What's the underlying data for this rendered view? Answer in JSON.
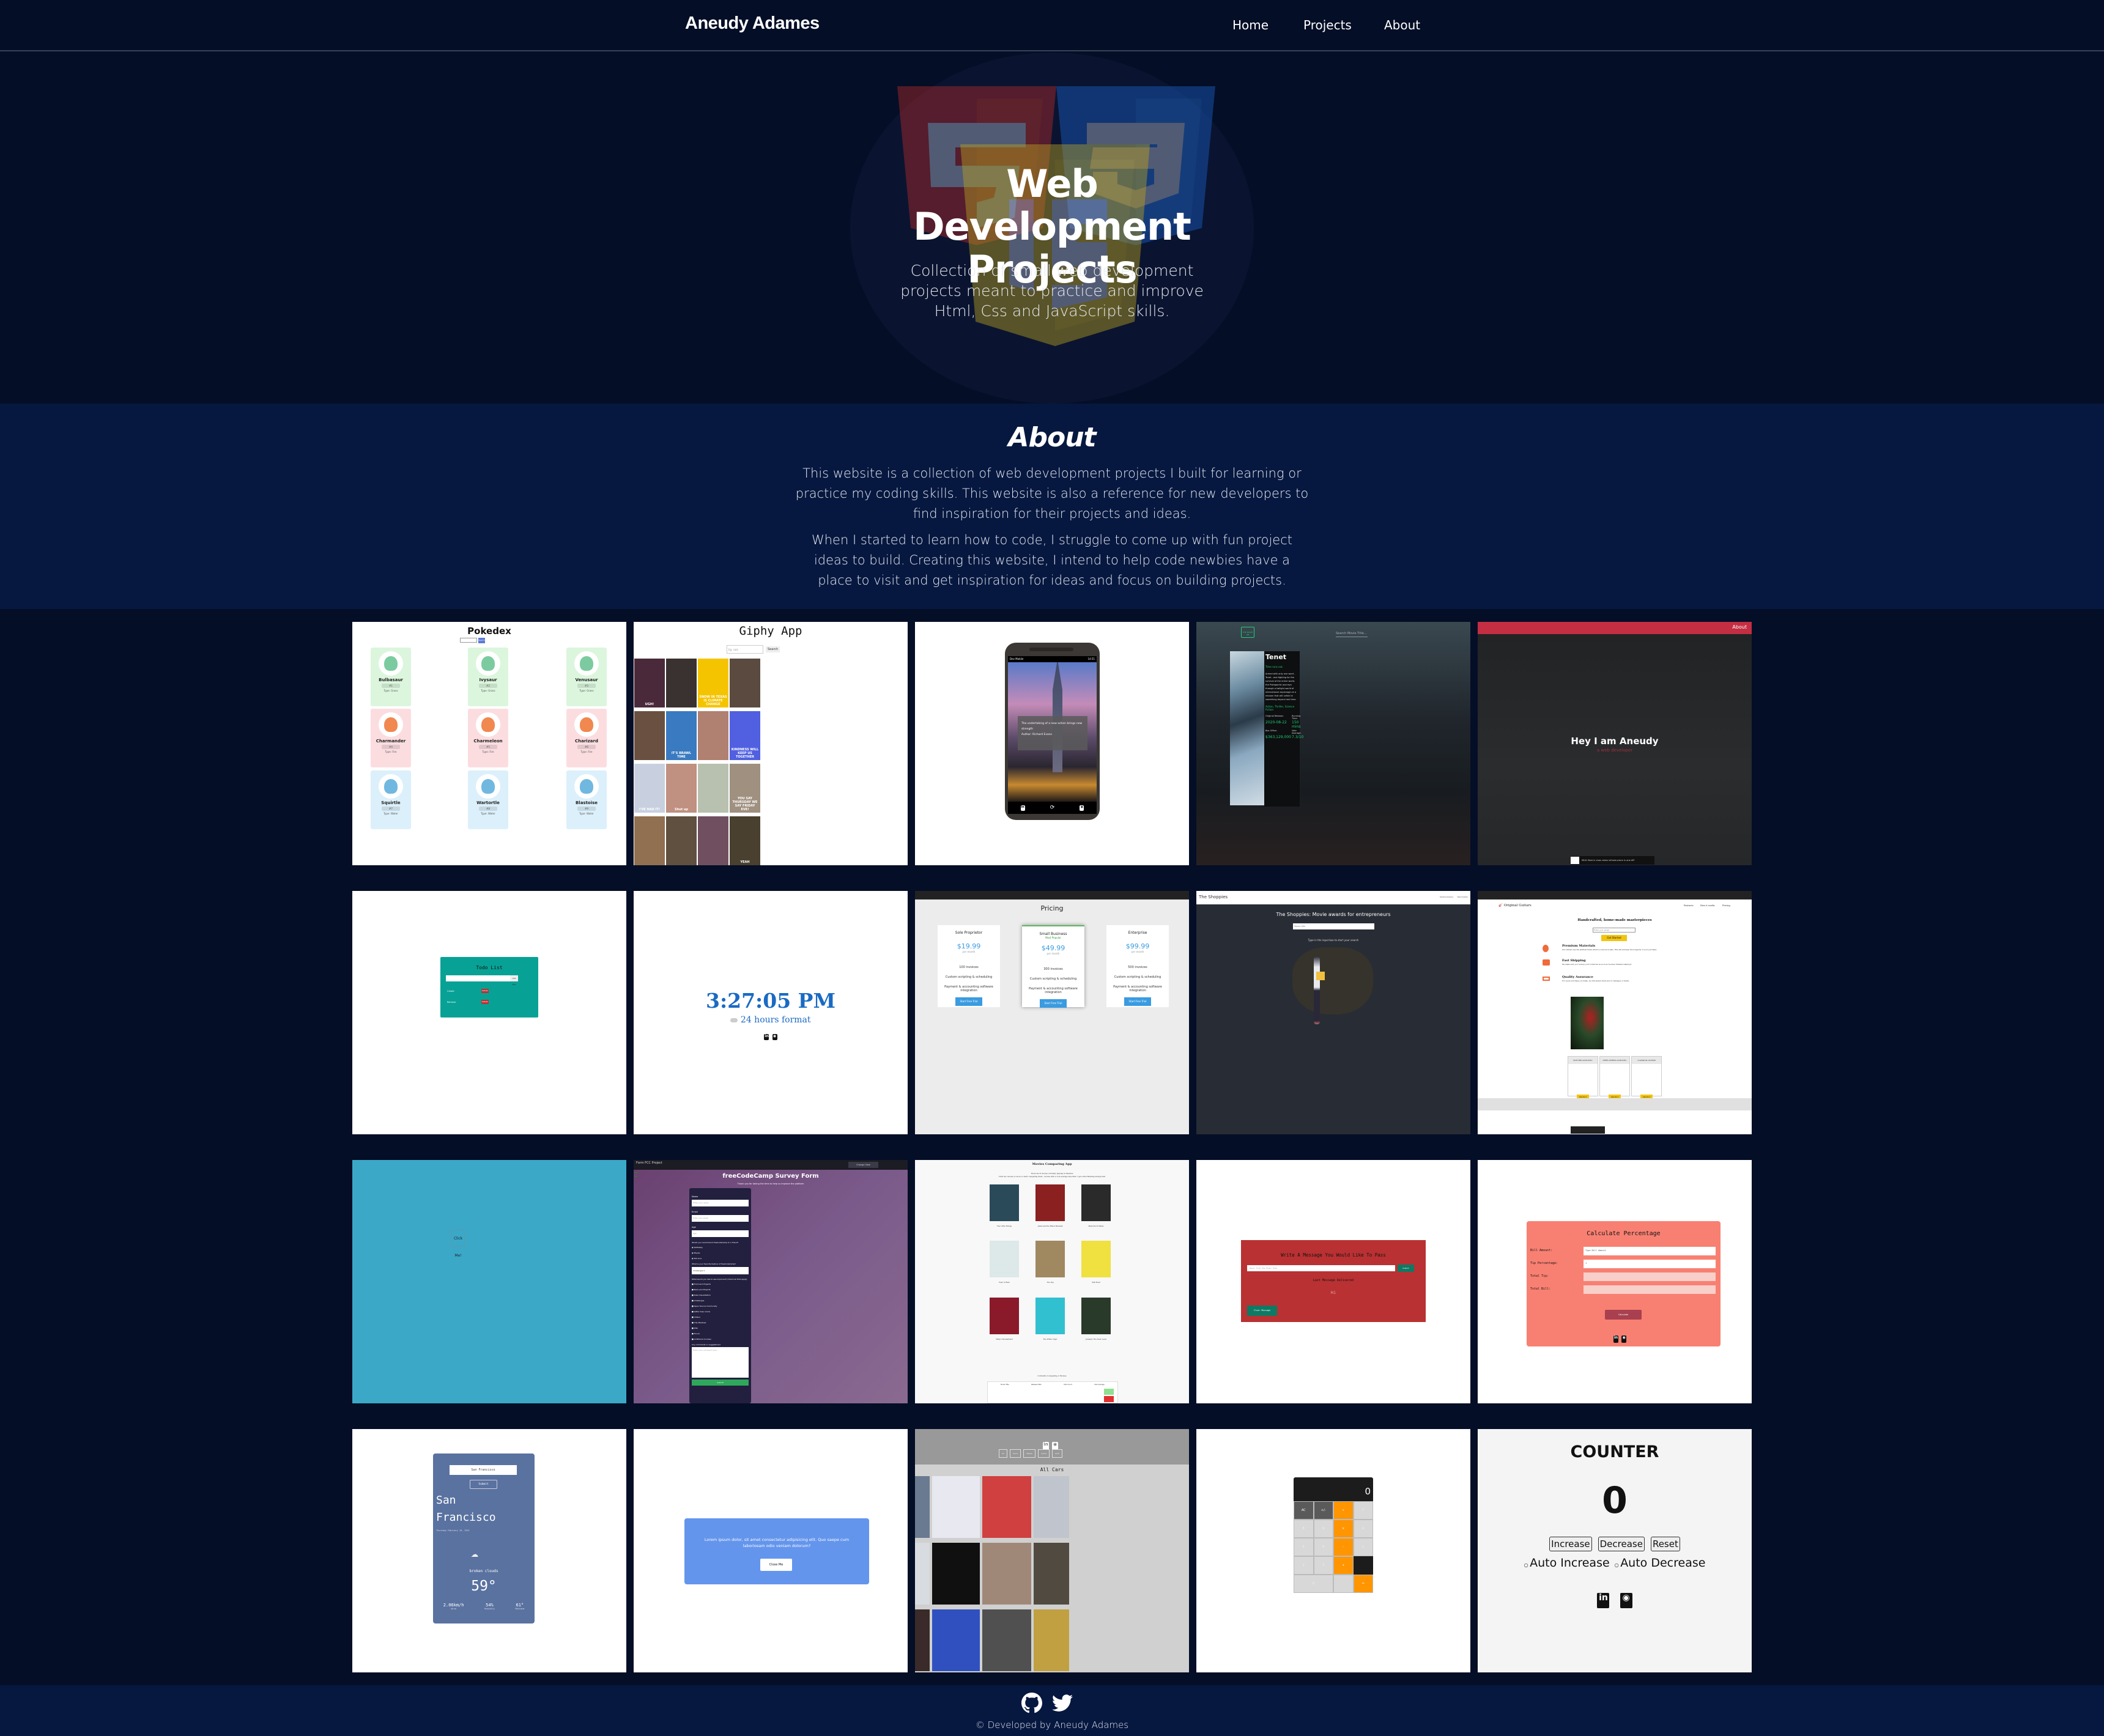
{
  "header": {
    "logo": "Aneudy Adames",
    "nav": [
      {
        "label": "Home"
      },
      {
        "label": "Projects"
      },
      {
        "label": "About"
      }
    ]
  },
  "hero": {
    "title": "Web Development Projects",
    "subtitle": "Collection of small web development projects meant to practice and improve Html, Css and JavaScript skills.",
    "background_icons": [
      "html5-icon",
      "css3-icon",
      "javascript-icon"
    ]
  },
  "about": {
    "heading": "About",
    "paragraphs": [
      "This website is a collection of web development projects I built for learning or practice my coding skills. This website is also a reference for new developers to find inspiration for their projects and ideas.",
      "When I started to learn how to code, I struggle to come up with fun project ideas to build. Creating this website, I intend to help code newbies have a place to visit and get inspiration for ideas and focus on building projects."
    ]
  },
  "projects": [
    {
      "name": "pokedex",
      "title": "Pokedex",
      "search_button": "Search",
      "pokemon": [
        {
          "name": "Bulbasaur",
          "number": "#1",
          "type": "Type: Grass"
        },
        {
          "name": "Ivysaur",
          "number": "#2",
          "type": "Type: Grass"
        },
        {
          "name": "Venusaur",
          "number": "#3",
          "type": "Type: Grass"
        },
        {
          "name": "Charmander",
          "number": "#4",
          "type": "Type: Fire"
        },
        {
          "name": "Charmeleon",
          "number": "#5",
          "type": "Type: Fire"
        },
        {
          "name": "Charizard",
          "number": "#6",
          "type": "Type: Fire"
        },
        {
          "name": "Squirtle",
          "number": "#7",
          "type": "Type: Water"
        },
        {
          "name": "Wartortle",
          "number": "#8",
          "type": "Type: Water"
        },
        {
          "name": "Blastoise",
          "number": "#9",
          "type": "Type: Water"
        }
      ]
    },
    {
      "name": "giphy-app",
      "title": "Giphy App",
      "search_placeholder": "Eg: cats",
      "search_button": "Search",
      "gif_captions": [
        "UGH!",
        "",
        "SNOW IN TEXAS IS CLIMATE CHANGE",
        "",
        "",
        "IT'S BRAWL TIME",
        "",
        "KINDNESS WILL KEEP US TOGETHER",
        "I'VE HAD IT!",
        "Shut up",
        "",
        "YOU SAY THURSDAY WE SAY FRIDAY EVE!",
        "",
        "",
        "",
        "YEAH"
      ]
    },
    {
      "name": "quote-generator",
      "carrier": "Dev Mobile",
      "time": "14:51",
      "quote": "The undertaking of a new action brings new strength",
      "author": "Author: Richard Evans"
    },
    {
      "name": "movie-db",
      "logo": "THE MOVIE DB",
      "search_placeholder": "Search Movie Title...",
      "movie_title": "Tenet",
      "tagline": "Time runs out.",
      "overview": "Armed with only one word - Tenet - and fighting for the survival of the entire world, the Protagonist journeys through a twilight world of international espionage on a mission that will unfold in something beyond real time.",
      "genres": "Action, Thriller, Science Fiction",
      "original_release_label": "Original Release:",
      "original_release": "2020-08-22",
      "running_time_label": "Running Time:",
      "running_time": "150 mins",
      "box_office_label": "Box Office:",
      "box_office": "$363,129,000",
      "vote_average_label": "Vote Average:",
      "vote_average": "7.3/10"
    },
    {
      "name": "portfolio-landing",
      "nav_link": "About",
      "heading": "Hey I am Aneudy",
      "subheading": "a web developer",
      "ad_text": "MUX: Best in class video infrastructure in one API"
    },
    {
      "name": "todo-list",
      "title": "Todo List",
      "add_button": "Add Task",
      "items": [
        {
          "label": "Create",
          "delete": "Delete"
        },
        {
          "label": "Remove",
          "delete": "Delete"
        }
      ]
    },
    {
      "name": "digital-clock",
      "time": "3:27:05 PM",
      "toggle_label": "24 hours format"
    },
    {
      "name": "pricing-page",
      "title": "Pricing",
      "plans": [
        {
          "name": "Sole Proprietor",
          "badge": "",
          "price": "$19.99",
          "period": "per month",
          "features": [
            "100 invoices",
            "Custom scripting & scheduling",
            "Payment & accounting software integration"
          ],
          "button": "Start Free Trial"
        },
        {
          "name": "Small Business",
          "badge": "Most Popular",
          "price": "$49.99",
          "period": "per month",
          "features": [
            "300 invoices",
            "Custom scripting & scheduling",
            "Payment & accounting software integration"
          ],
          "button": "Start Free Trial"
        },
        {
          "name": "Enterprise",
          "badge": "",
          "price": "$99.99",
          "period": "per month",
          "features": [
            "500 invoices",
            "Custom scripting & scheduling",
            "Payment & accounting software integration"
          ],
          "button": "Start Free Trial"
        }
      ]
    },
    {
      "name": "shoppies",
      "brand": "The Shoppies",
      "nav": [
        "Nominations",
        "Nominees"
      ],
      "title": "The Shoppies: Movie awards for entrepreneurs",
      "search_placeholder": "Movie title",
      "hint": "Type in the input box to start your search"
    },
    {
      "name": "original-guitars",
      "brand": "Original Guitars",
      "nav": [
        "Features",
        "How it works",
        "Pricing"
      ],
      "headline": "Handcrafted, home-made masterpieces",
      "email_placeholder": "Enter your email",
      "cta": "Get Started",
      "features": [
        {
          "title": "Premium Materials",
          "text": "Our Guitars use the shittiest brass which is sourced locally. This will increase the longevity of your purchase."
        },
        {
          "title": "Fast Shipping",
          "text": "We make sure you recieve your trombone as soon as we have finished making it."
        },
        {
          "title": "Quality Assurance",
          "text": "For every purchase you make, we will ensure there are no damages or faults."
        }
      ],
      "tiers": [
        {
          "name": "ELECTRO-ACOUSTIC",
          "button": "SELECT"
        },
        {
          "name": "STEEL-STRING ACOUSTIC",
          "button": "SELECT"
        },
        {
          "name": "CLASSICAL GUITAR",
          "button": "SELECT"
        }
      ]
    },
    {
      "name": "click-me",
      "button": "Click Me!"
    },
    {
      "name": "survey-form",
      "topbar_title": "Form FCC Project",
      "change_view": "Change View",
      "title": "freeCodeCamp Survey Form",
      "subtitle": "Thank you for taking the time to help us improve the platform",
      "fields": [
        {
          "label": "Name",
          "placeholder": "Enter your name"
        },
        {
          "label": "Email",
          "placeholder": "Enter your email"
        },
        {
          "label": "Age",
          "placeholder": "Age"
        }
      ],
      "recommend_question": "Would you recommend freeCodeCamp to a friend?",
      "recommend_options": [
        "Definitely",
        "Maybe",
        "Not sure"
      ],
      "feature_question": "What is your favorite feature of freeCodeCamp?",
      "feature_select": "Challenges",
      "improve_question": "What would you like to see improved? (Check all that apply)",
      "improve_options": [
        "Front-end Projects",
        "Back-end Projects",
        "Data Visualization",
        "Challenges",
        "Open Source Community",
        "Gitter help rooms",
        "Videos",
        "City Meetups",
        "Wiki",
        "Forum",
        "Additional Courses"
      ],
      "comments_label": "Any comments or suggestions?",
      "comments_placeholder": "Enter your comment here...",
      "submit": "Submit"
    },
    {
      "name": "movies-comparing",
      "title": "Movies Comparing App",
      "intro": "There are 9 movies currently playing in theaters",
      "instructions": "Click two movies or more to start comparing them , movies with a vote average less than 7 get a Red Warning background",
      "movies": [
        "The Little Things",
        "Judas and the Black Messiah",
        "Malcolm & Marie",
        "Fear of Rain",
        "The Dig",
        "Silk Road",
        "Willy's Wonderland",
        "The White Tiger",
        "Jumanji: The Next Level"
      ],
      "table_title": "Currently Comparing 2 Movies",
      "table_headers": [
        "Movie Title",
        "Release Date",
        "Vote Count",
        "Vote Average"
      ]
    },
    {
      "name": "message-passer",
      "title": "Write A Message You Would Like To Pass",
      "input_placeholder": "Hello From The Other Side",
      "submit": "Submit",
      "last_label": "Last Message Delivered",
      "last_message": "Hi",
      "clear": "Clear Message"
    },
    {
      "name": "tip-calculator",
      "title": "Calculate Percentage",
      "rows": [
        {
          "label": "Bill Amount:",
          "value": "Type Bill Amount"
        },
        {
          "label": "Tip Percentage:",
          "value": "1"
        },
        {
          "label": "Total Tip:",
          "value": ""
        },
        {
          "label": "Total Bill:",
          "value": ""
        }
      ],
      "button": "Calculate"
    },
    {
      "name": "weather-app",
      "input_value": "San Francisco",
      "submit": "Submit",
      "city": "San Francisco",
      "date": "Thursday February 18, 2021",
      "condition": "broken clouds",
      "temperature": "59°",
      "stats": [
        {
          "value": "2.06km/h",
          "label": "Wind"
        },
        {
          "value": "54%",
          "label": "Humidity"
        },
        {
          "value": "61°",
          "label": "Maximum"
        }
      ]
    },
    {
      "name": "modal",
      "text": "Lorem ipsum dolor, sit amet consectetur adipisicing elit. Quo saepe cum laboriosam odio veniam dolorum?",
      "button": "Close Me"
    },
    {
      "name": "car-gallery",
      "filters": [
        "All",
        "Acura",
        "Nissan",
        "Lexus",
        "Audi"
      ],
      "heading": "All Cars"
    },
    {
      "name": "calculator",
      "display": "0",
      "keys": [
        "AC",
        "+/-",
        "÷",
        "7",
        "8",
        "9",
        "×",
        "4",
        "5",
        "6",
        "-",
        "1",
        "2",
        "3",
        "+",
        "0",
        ".",
        "="
      ]
    },
    {
      "name": "counter",
      "title": "COUNTER",
      "value": "0",
      "buttons": [
        "Increase",
        "Decrease",
        "Reset"
      ],
      "auto_options": [
        "Auto Increase",
        "Auto Decrease"
      ]
    }
  ],
  "footer": {
    "icons": [
      "github-icon",
      "twitter-icon"
    ],
    "text": "© Developed by Aneudy Adames"
  },
  "colors": {
    "page_bg": "#040e26",
    "section_bg": "#061840",
    "movie_accent": "#1fd07a",
    "portfolio_red": "#c42e43",
    "todo_teal": "#07a295",
    "clock_blue": "#1a6ac4",
    "message_red": "#b93132",
    "tip_salmon": "#f88072",
    "weather_blue": "#5a72a0",
    "modal_blue": "#6495ed",
    "calculator_orange": "#ff9500"
  }
}
